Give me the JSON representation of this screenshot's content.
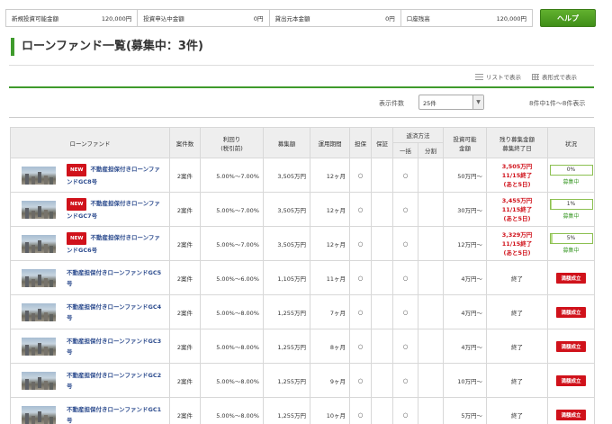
{
  "summary": {
    "items": [
      {
        "label": "新規投資可能金額",
        "value": "120,000円"
      },
      {
        "label": "投資申込中金額",
        "value": "0円"
      },
      {
        "label": "貸出元本金額",
        "value": "0円"
      },
      {
        "label": "口座残高",
        "value": "120,000円"
      }
    ]
  },
  "help_button": "ヘルプ",
  "page_title": "ローンファンド一覧(募集中：3件)",
  "view_toggle": {
    "list": "リストで表示",
    "table": "表形式で表示"
  },
  "display_count_label": "表示件数",
  "display_count_value": "25件",
  "range_label": "8件中1件～8件表示",
  "table_headers": {
    "fund": "ローンファンド",
    "cases": "案件数",
    "yield_line1": "利回り",
    "yield_line2": "(税引前)",
    "amount": "募集額",
    "period": "運用期間",
    "collateral": "担保",
    "guarantee": "保証",
    "repayment": "返済方法",
    "lump": "一括",
    "split": "分割",
    "investable_line1": "投資可能",
    "investable_line2": "金額",
    "remaining_line1": "残り募集金額",
    "remaining_line2": "募集終了日",
    "status": "状況"
  },
  "new_label": "NEW",
  "rows": [
    {
      "name": "不動産担保付きローンファンドGC8号",
      "is_new": true,
      "cases": "2案件",
      "yield": "5.00%～7.00%",
      "amount": "3,505万円",
      "period": "12ヶ月",
      "collateral": "○",
      "guarantee": "",
      "lump": "○",
      "split": "",
      "investable": "50万円～",
      "remaining": "3,505万円",
      "end_date": "11/15終了",
      "days_left": "(あと5日)",
      "progress": 0,
      "progress_label": "0%",
      "status": "募集中"
    },
    {
      "name": "不動産担保付きローンファンドGC7号",
      "is_new": true,
      "cases": "2案件",
      "yield": "5.00%～7.00%",
      "amount": "3,505万円",
      "period": "12ヶ月",
      "collateral": "○",
      "guarantee": "",
      "lump": "○",
      "split": "",
      "investable": "30万円～",
      "remaining": "3,455万円",
      "end_date": "11/15終了",
      "days_left": "(あと5日)",
      "progress": 1,
      "progress_label": "1%",
      "status": "募集中"
    },
    {
      "name": "不動産担保付きローンファンドGC6号",
      "is_new": true,
      "cases": "2案件",
      "yield": "5.00%～7.00%",
      "amount": "3,505万円",
      "period": "12ヶ月",
      "collateral": "○",
      "guarantee": "",
      "lump": "○",
      "split": "",
      "investable": "12万円～",
      "remaining": "3,329万円",
      "end_date": "11/15終了",
      "days_left": "(あと5日)",
      "progress": 5,
      "progress_label": "5%",
      "status": "募集中"
    },
    {
      "name": "不動産担保付きローンファンドGC5号",
      "is_new": false,
      "cases": "2案件",
      "yield": "5.00%～6.00%",
      "amount": "1,105万円",
      "period": "11ヶ月",
      "collateral": "○",
      "guarantee": "",
      "lump": "○",
      "split": "",
      "investable": "4万円～",
      "remaining": "終了",
      "status": "満額成立"
    },
    {
      "name": "不動産担保付きローンファンドGC4号",
      "is_new": false,
      "cases": "2案件",
      "yield": "5.00%～8.00%",
      "amount": "1,255万円",
      "period": "7ヶ月",
      "collateral": "○",
      "guarantee": "",
      "lump": "○",
      "split": "",
      "investable": "4万円～",
      "remaining": "終了",
      "status": "満額成立"
    },
    {
      "name": "不動産担保付きローンファンドGC3号",
      "is_new": false,
      "cases": "2案件",
      "yield": "5.00%～8.00%",
      "amount": "1,255万円",
      "period": "8ヶ月",
      "collateral": "○",
      "guarantee": "",
      "lump": "○",
      "split": "",
      "investable": "4万円～",
      "remaining": "終了",
      "status": "満額成立"
    },
    {
      "name": "不動産担保付きローンファンドGC2号",
      "is_new": false,
      "cases": "2案件",
      "yield": "5.00%～8.00%",
      "amount": "1,255万円",
      "period": "9ヶ月",
      "collateral": "○",
      "guarantee": "",
      "lump": "○",
      "split": "",
      "investable": "10万円～",
      "remaining": "終了",
      "status": "満額成立"
    },
    {
      "name": "不動産担保付きローンファンドGC1号",
      "is_new": false,
      "cases": "2案件",
      "yield": "5.00%～8.00%",
      "amount": "1,255万円",
      "period": "10ヶ月",
      "collateral": "○",
      "guarantee": "",
      "lump": "○",
      "split": "",
      "investable": "5万円～",
      "remaining": "終了",
      "status": "満額成立"
    }
  ],
  "colors": {
    "accent_green": "#3f9b2c",
    "alert_red": "#d0121b",
    "link_blue": "#2e4d8f"
  }
}
